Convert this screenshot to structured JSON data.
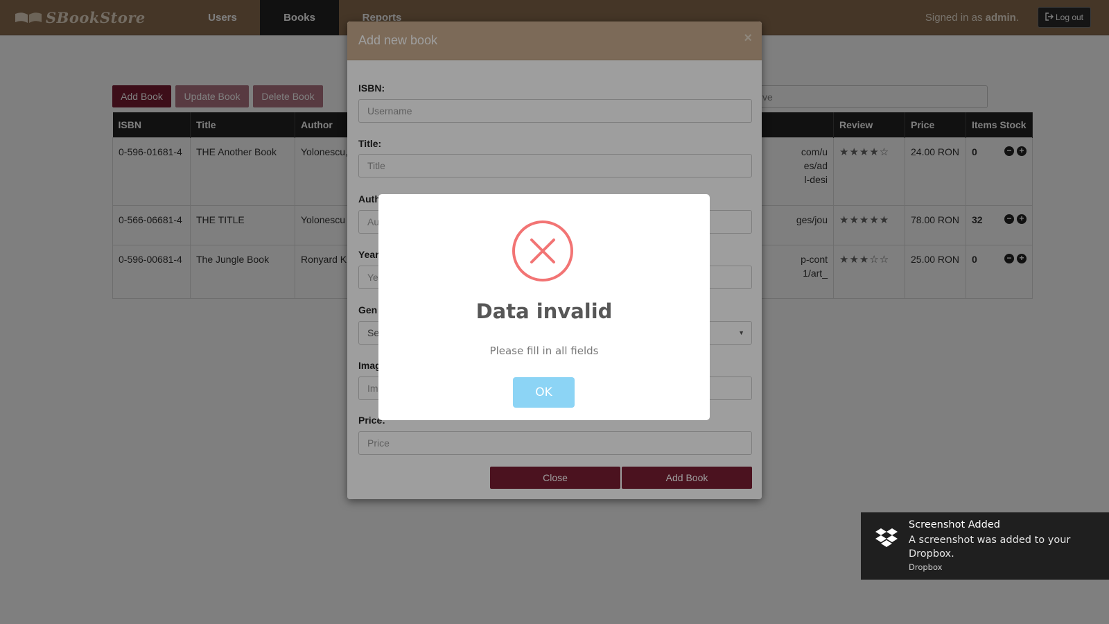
{
  "nav": {
    "brand": "SBookStore",
    "tabs": [
      {
        "label": "Users"
      },
      {
        "label": "Books"
      },
      {
        "label": "Reports"
      }
    ],
    "signed_in_prefix": "Signed in as ",
    "signed_in_user": "admin",
    "signed_in_suffix": ".",
    "logout_label": "Log out"
  },
  "toolbar": {
    "add_label": "Add Book",
    "update_label": "Update Book",
    "delete_label": "Delete Book",
    "search_value": "ve"
  },
  "table": {
    "headers": [
      "ISBN",
      "Title",
      "Author",
      "",
      "Review",
      "Price",
      "Items Stock"
    ],
    "rows": [
      {
        "isbn": "0-596-01681-4",
        "title": "THE Another Book",
        "author": "Yolonescu,",
        "image_url": "com/u\nes/ad\nl-desi",
        "stars": "★★★★☆",
        "price": "24.00 RON",
        "stock": "0"
      },
      {
        "isbn": "0-566-06681-4",
        "title": "THE TITLE",
        "author": "Yolonescu",
        "image_url": "ges/jou",
        "stars": "★★★★★",
        "price": "78.00 RON",
        "stock": "32"
      },
      {
        "isbn": "0-596-00681-4",
        "title": "The Jungle Book",
        "author": "Ronyard K",
        "image_url": "p-cont\n1/art_",
        "stars": "★★★☆☆",
        "price": "25.00 RON",
        "stock": "0"
      }
    ]
  },
  "modal": {
    "title": "Add new book",
    "close_x": "×",
    "fields": {
      "isbn_label": "ISBN:",
      "isbn_placeholder": "Username",
      "title_label": "Title:",
      "title_placeholder": "Title",
      "author_label": "Auth",
      "author_placeholder": "Au",
      "year_label": "Year",
      "year_placeholder": "Ye",
      "genre_label": "Gen",
      "genre_value": "Se",
      "image_label": "Imag",
      "image_placeholder": "Im",
      "price_label": "Price:",
      "price_placeholder": "Price"
    },
    "close_button": "Close",
    "add_button": "Add Book"
  },
  "alert": {
    "title": "Data invalid",
    "text": "Please fill in all fields",
    "ok_label": "OK",
    "icon": "error-x-icon",
    "icon_color": "#f27474"
  },
  "toast": {
    "title": "Screenshot Added",
    "message": "A screenshot was added to your Dropbox.",
    "source": "Dropbox",
    "icon": "dropbox-icon"
  },
  "colors": {
    "navbar": "#8a6d4f",
    "accent": "#7a1d33",
    "modal_header": "#c8ac8e",
    "ok_button": "#8cd4f5"
  }
}
